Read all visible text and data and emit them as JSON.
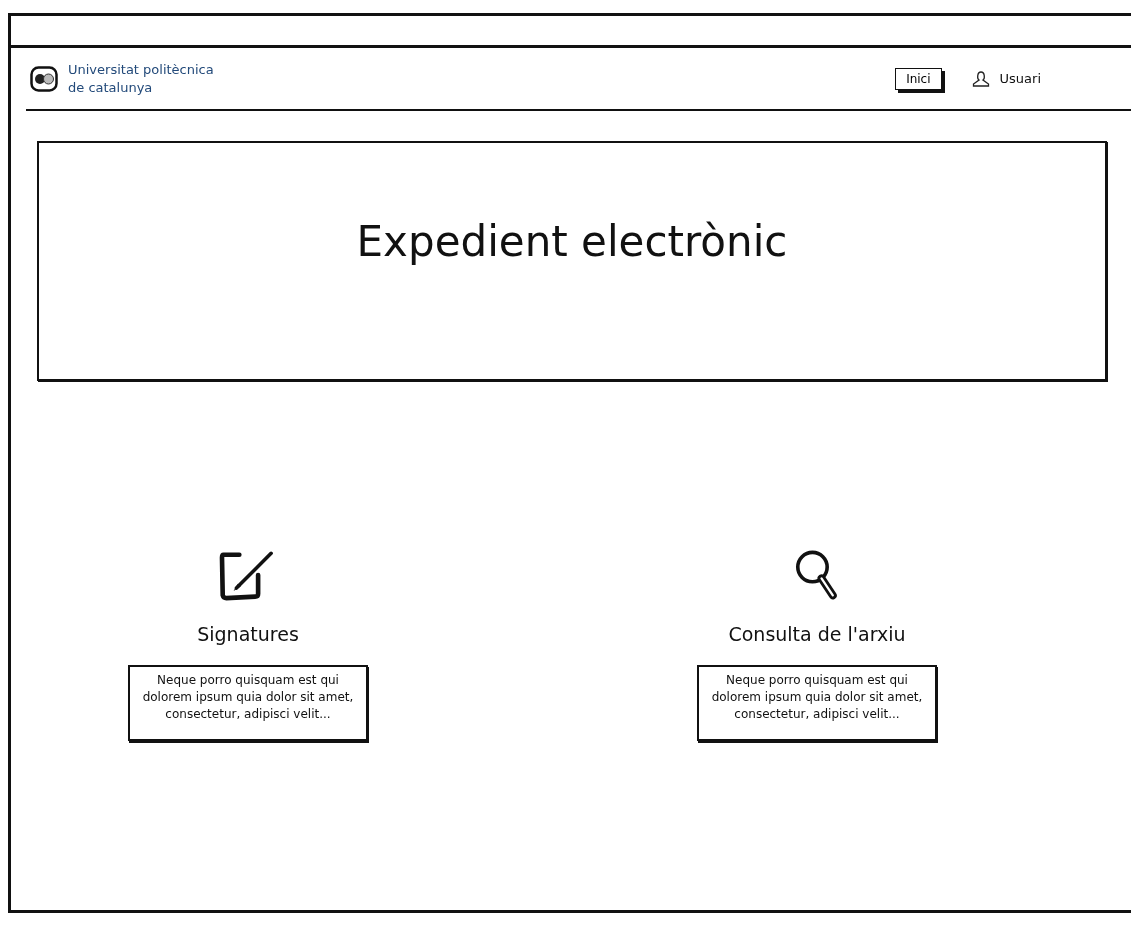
{
  "header": {
    "logo_lines": [
      "Universitat politècnica",
      "de catalunya"
    ],
    "nav": [
      {
        "label": "Inici",
        "selected": true
      }
    ],
    "user": "Usuari"
  },
  "banner": {
    "title": "Expedient electrònic"
  },
  "features": [
    {
      "kind": "edit",
      "title": "Signatures",
      "description": "Neque porro quisquam est qui dolorem ipsum quia dolor sit amet, consectetur, adipisci velit..."
    },
    {
      "kind": "search",
      "title": "Consulta de l'arxiu",
      "description": "Neque porro quisquam est qui dolorem ipsum quia dolor sit amet, consectetur, adipisci velit..."
    }
  ]
}
